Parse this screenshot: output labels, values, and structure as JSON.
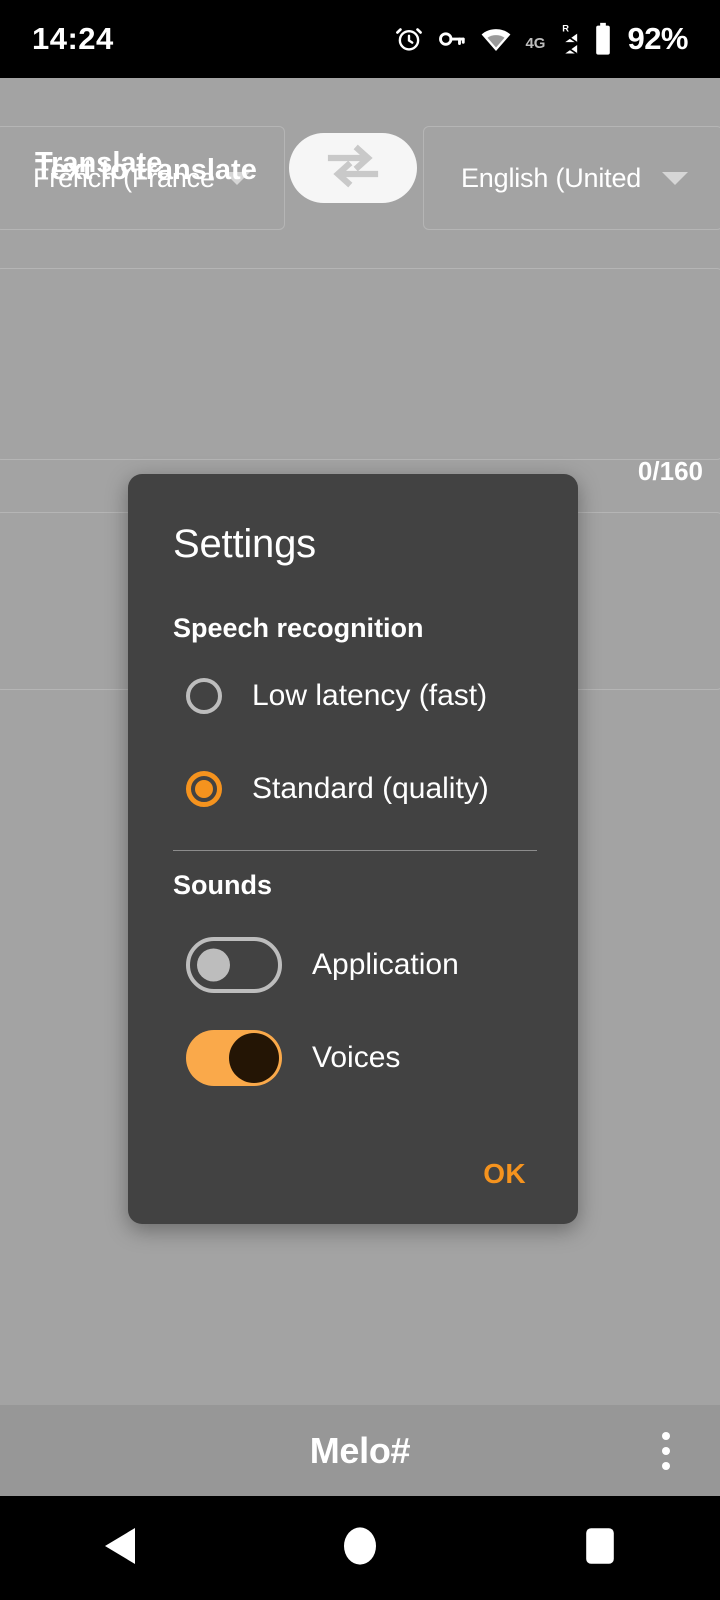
{
  "status_bar": {
    "clock": "14:24",
    "battery_percent": "92%",
    "network_label": "4G",
    "roaming_label": "R",
    "icons": [
      "alarm-icon",
      "vpn-key-icon",
      "wifi-icon",
      "mobile-signal-icon",
      "battery-icon"
    ]
  },
  "translator": {
    "source_language": "French (France",
    "target_language": "English (United",
    "swap_icon": "swap-horizontal-icon",
    "input_placeholder": "Text to translate",
    "char_counter": "0/160",
    "output_placeholder": "Translate"
  },
  "dialog": {
    "title": "Settings",
    "sections": [
      {
        "header": "Speech recognition",
        "options": [
          {
            "label": "Low latency (fast)",
            "selected": false
          },
          {
            "label": "Standard (quality)",
            "selected": true
          }
        ]
      },
      {
        "header": "Sounds",
        "switches": [
          {
            "label": "Application",
            "on": false
          },
          {
            "label": "Voices",
            "on": true
          }
        ]
      }
    ],
    "ok_label": "OK"
  },
  "bottom_bar": {
    "app_title": "Melo#",
    "overflow_icon": "overflow-menu-icon"
  },
  "nav_bar": {
    "back_icon": "back-triangle-icon",
    "home_icon": "home-circle-icon",
    "recents_icon": "recents-square-icon"
  },
  "colors": {
    "accent_orange": "#F5931E",
    "switch_on_track": "#FAA94A",
    "switch_on_knob": "#241505",
    "dialog_background": "#424242",
    "scrim_background": "#A3A3A3",
    "bottom_bar": "#979797",
    "system_bar": "#000000"
  }
}
